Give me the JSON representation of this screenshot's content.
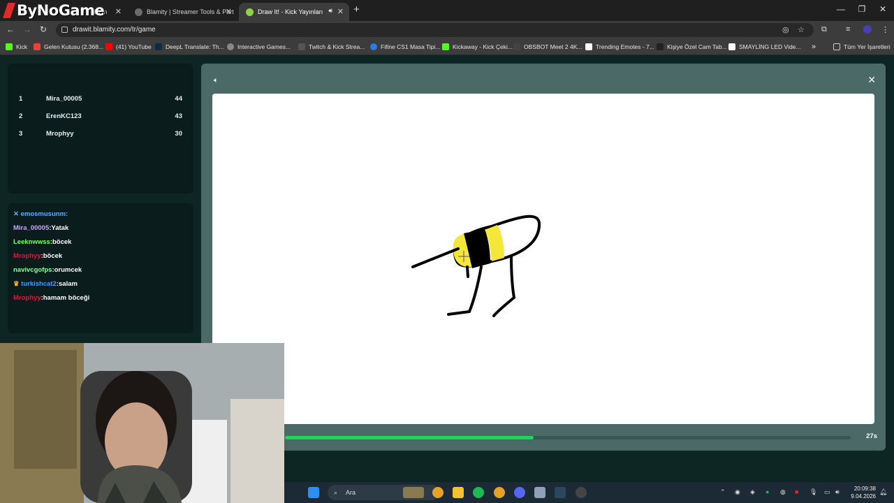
{
  "browser": {
    "brand": "ByNoGame",
    "tabs": [
      {
        "label": "ld's m"
      },
      {
        "label": "Blamity | Streamer Tools & Part"
      },
      {
        "label": "Draw It! - Kick Yayınları İçin"
      }
    ],
    "new_tab": "+",
    "url": "drawit.blamity.com/tr/game",
    "bookmarks": [
      {
        "label": "Kick",
        "color": "#53fc18"
      },
      {
        "label": "Gelen Kutusu (2.368...",
        "color": "#ea4335"
      },
      {
        "label": "(41) YouTube",
        "color": "#ff0000"
      },
      {
        "label": "DeepL Translate: Th...",
        "color": "#0f2b46"
      },
      {
        "label": "Interactive Games...",
        "color": "#888888"
      },
      {
        "label": "Twitch & Kick Strea...",
        "color": "#555555"
      },
      {
        "label": "Fifine CS1 Masa Tipi...",
        "color": "#2a7de1"
      },
      {
        "label": "Kickaway - Kick Çeki...",
        "color": "#53fc18"
      },
      {
        "label": "OBSBOT Meet 2 4K...",
        "color": "#444444"
      },
      {
        "label": "Trending Emotes - 7...",
        "color": "#ffffff"
      },
      {
        "label": "Kişiye Özel Cam Tab...",
        "color": "#222222"
      },
      {
        "label": "SMAYLİNG LED Vide...",
        "color": "#ffffff"
      }
    ],
    "bookmarks_more": "»",
    "all_bookmarks": "Tüm Yer İşaretleri"
  },
  "leaderboard": [
    {
      "rank": "1",
      "name": "Mira_00005",
      "score": "44"
    },
    {
      "rank": "2",
      "name": "ErenKC123",
      "score": "43"
    },
    {
      "rank": "3",
      "name": "Mrophyy",
      "score": "30"
    }
  ],
  "chat": [
    {
      "user": "emosmusunm:",
      "text": "",
      "color": "#5fb0ff"
    },
    {
      "user": "Mira_00005",
      "text": ":Yatak",
      "color": "#c9a6ff"
    },
    {
      "user": "Leeknwwss",
      "text": ":böcek",
      "color": "#7cff6a"
    },
    {
      "user": "Mrophyy",
      "text": ":böcek",
      "color": "#e0163f"
    },
    {
      "user": "navivcgofps",
      "text": ":orumcek",
      "color": "#8dff9a"
    },
    {
      "user": "turkishcat2",
      "text": ":salam",
      "color": "#3aa0ff"
    },
    {
      "user": "Mrophyy",
      "text": ":hamam böceği",
      "color": "#e0163f"
    }
  ],
  "game": {
    "timer_label": "27s",
    "timer_progress": 0.44,
    "sound_icon": "speaker-icon",
    "close_icon": "close-icon"
  },
  "taskbar": {
    "search_placeholder": "Ara",
    "time": "20:09:38",
    "date": "9.04.2026"
  },
  "colors": {
    "accent_green": "#22d35f",
    "panel": "#4a6967",
    "page_bg": "#0d2523"
  }
}
